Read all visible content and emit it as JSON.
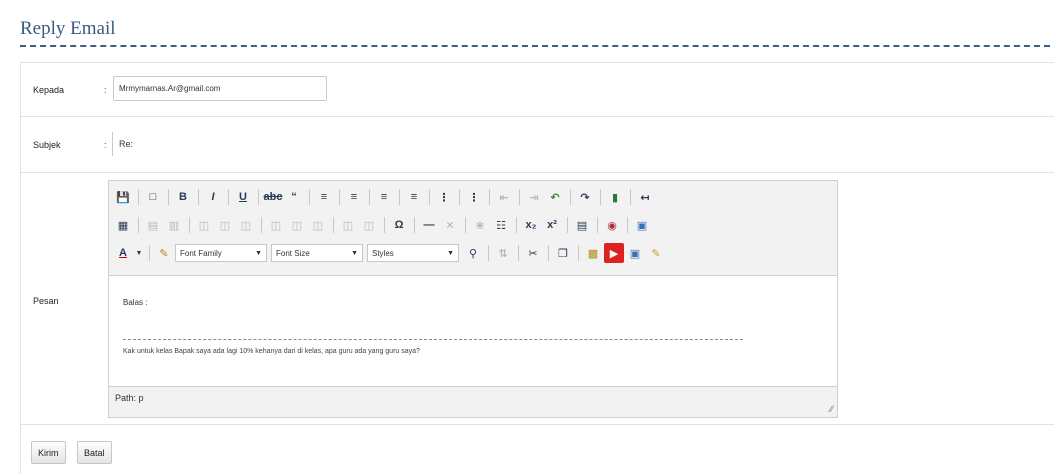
{
  "page": {
    "title": "Reply Email"
  },
  "form": {
    "to": {
      "label": "Kepada",
      "colon": ":",
      "value": "Mrmymarnas.Ar@gmail.com"
    },
    "subject": {
      "label": "Subjek",
      "colon": ":",
      "value": "Re:"
    },
    "message": {
      "label": "Pesan"
    }
  },
  "editor": {
    "font_family_label": "Font Family",
    "font_size_label": "Font Size",
    "styles_label": "Styles",
    "body_greeting": "Balas :",
    "body_quote": "Kak untuk kelas Bapak saya ada lagi 10% kehanya dari di kelas, apa guru ada yang guru saya?",
    "status_path": "Path: p"
  },
  "buttons": {
    "send_label": "Kirim",
    "cancel_label": "Batal"
  },
  "colors": {
    "title": "#3a5a80",
    "rule": "#3b5f86",
    "toolbar_bg": "#f2f2f2"
  },
  "icons": {
    "row1": [
      "save-icon",
      "new-document-icon",
      "bold-icon",
      "italic-icon",
      "underline-icon",
      "strikethrough-icon",
      "blockquote-icon",
      "align-left-icon",
      "align-center-icon",
      "align-right-icon",
      "align-justify-icon",
      "bullet-list-icon",
      "numbered-list-icon",
      "outdent-icon",
      "indent-icon",
      "undo-icon",
      "redo-icon",
      "link-icon",
      "unlink-icon"
    ],
    "row2": [
      "table-icon",
      "row-insert-icon",
      "column-icon",
      "cell-icon",
      "omega-icon",
      "horizontal-rule-icon",
      "remove-format-icon",
      "cleanup-icon",
      "subscript-icon",
      "superscript-icon",
      "charmap-icon",
      "media-icon",
      "visual-aid-icon"
    ],
    "row3": [
      "text-color-icon",
      "highlight-icon",
      "find-icon",
      "replace-icon",
      "cut-icon",
      "copy-icon",
      "paste-icon",
      "youtube-icon",
      "image-icon",
      "edit-pencil-icon"
    ]
  }
}
